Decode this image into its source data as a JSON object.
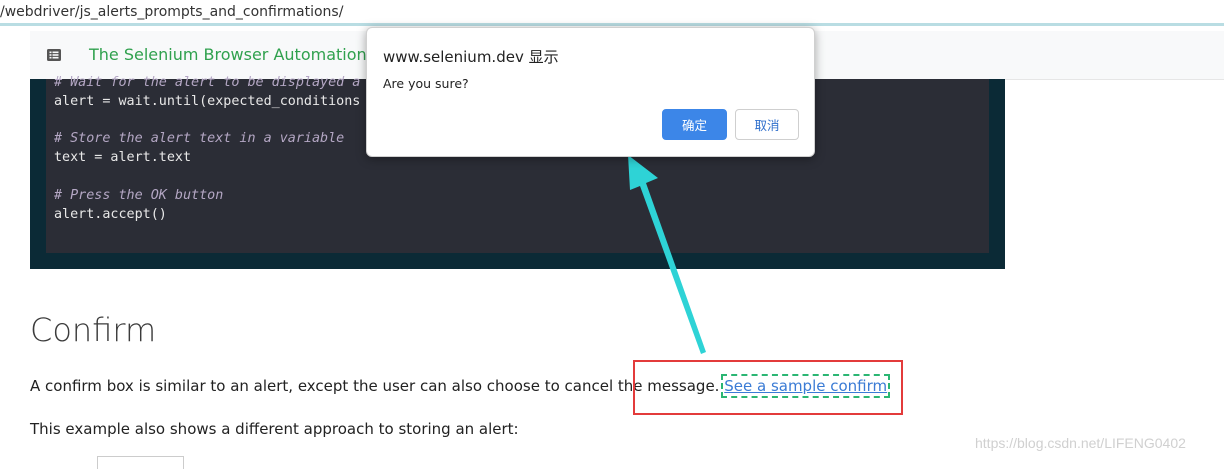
{
  "browser": {
    "url": "/webdriver/js_alerts_prompts_and_confirmations/"
  },
  "site": {
    "title": "The Selenium Browser Automation Proj",
    "menu_icon": "list-icon"
  },
  "code": [
    {
      "type": "comment",
      "text": "# Wait for the alert to be displayed a"
    },
    {
      "type": "code",
      "text": "alert = wait.until(expected_conditions"
    },
    {
      "type": "comment",
      "text": "# Store the alert text in a variable"
    },
    {
      "type": "code",
      "text": "text = alert.text"
    },
    {
      "type": "comment",
      "text": "# Press the OK button"
    },
    {
      "type": "code",
      "text": "alert.accept()"
    }
  ],
  "content": {
    "heading": "Confirm",
    "para1": "A confirm box is similar to an alert, except the user can also choose to cancel the message.",
    "link": "See a sample confirm",
    "para2": "This example also shows a different approach to storing an alert:"
  },
  "dialog": {
    "title": "www.selenium.dev 显示",
    "message": "Are you sure?",
    "ok_label": "确定",
    "cancel_label": "取消"
  },
  "annotation": {
    "box_color": "#e33b3b",
    "arrow_color": "#2ed3d6"
  },
  "watermark": "https://blog.csdn.net/LIFENG0402"
}
